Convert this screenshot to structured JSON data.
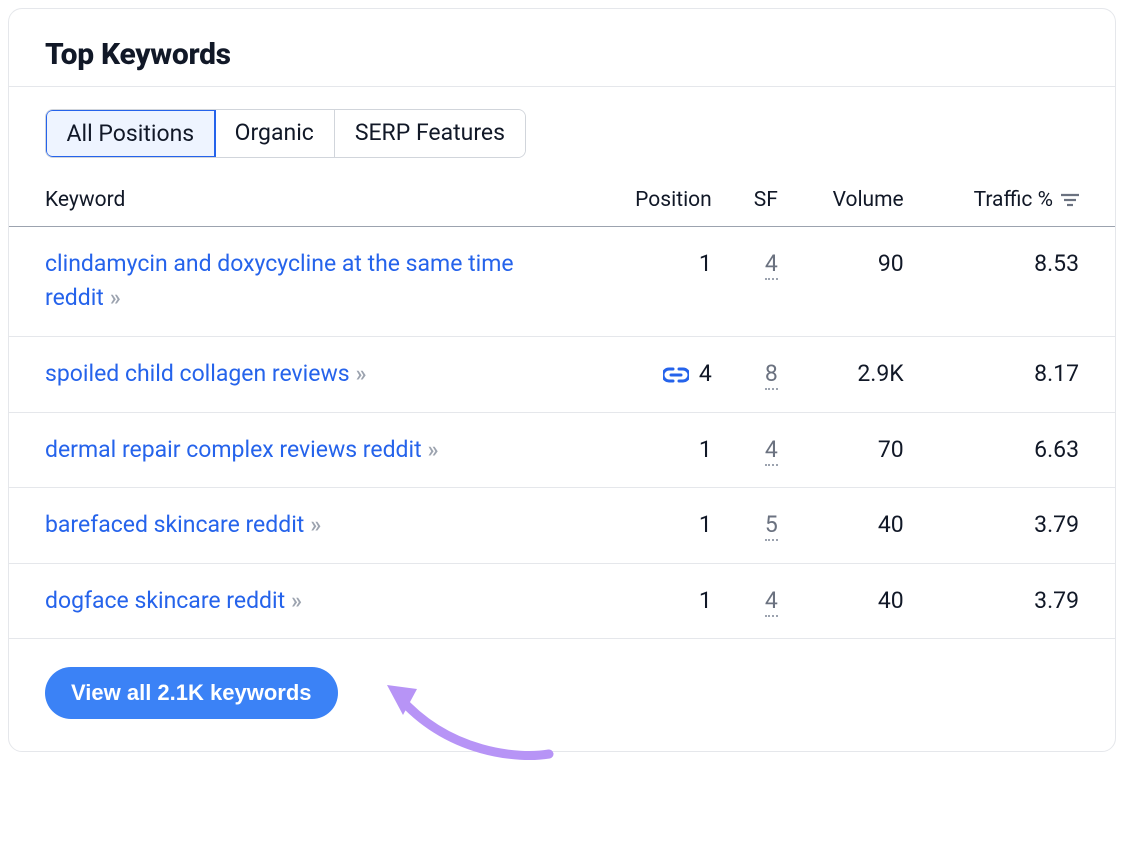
{
  "card": {
    "title": "Top Keywords"
  },
  "tabs": [
    {
      "label": "All Positions",
      "active": true
    },
    {
      "label": "Organic",
      "active": false
    },
    {
      "label": "SERP Features",
      "active": false
    }
  ],
  "columns": {
    "keyword": "Keyword",
    "position": "Position",
    "sf": "SF",
    "volume": "Volume",
    "traffic": "Traffic %"
  },
  "rows": [
    {
      "keyword": "clindamycin and doxycycline at the same time reddit",
      "position": "1",
      "position_icon": null,
      "sf": "4",
      "volume": "90",
      "traffic": "8.53"
    },
    {
      "keyword": "spoiled child collagen reviews",
      "position": "4",
      "position_icon": "link",
      "sf": "8",
      "volume": "2.9K",
      "traffic": "8.17"
    },
    {
      "keyword": "dermal repair complex reviews reddit",
      "position": "1",
      "position_icon": null,
      "sf": "4",
      "volume": "70",
      "traffic": "6.63"
    },
    {
      "keyword": "barefaced skincare reddit",
      "position": "1",
      "position_icon": null,
      "sf": "5",
      "volume": "40",
      "traffic": "3.79"
    },
    {
      "keyword": "dogface skincare reddit",
      "position": "1",
      "position_icon": null,
      "sf": "4",
      "volume": "40",
      "traffic": "3.79"
    }
  ],
  "footer": {
    "view_all_label": "View all 2.1K keywords"
  },
  "colors": {
    "link": "#2563eb",
    "primary_button": "#3b82f6",
    "annotation": "#b794f6"
  }
}
